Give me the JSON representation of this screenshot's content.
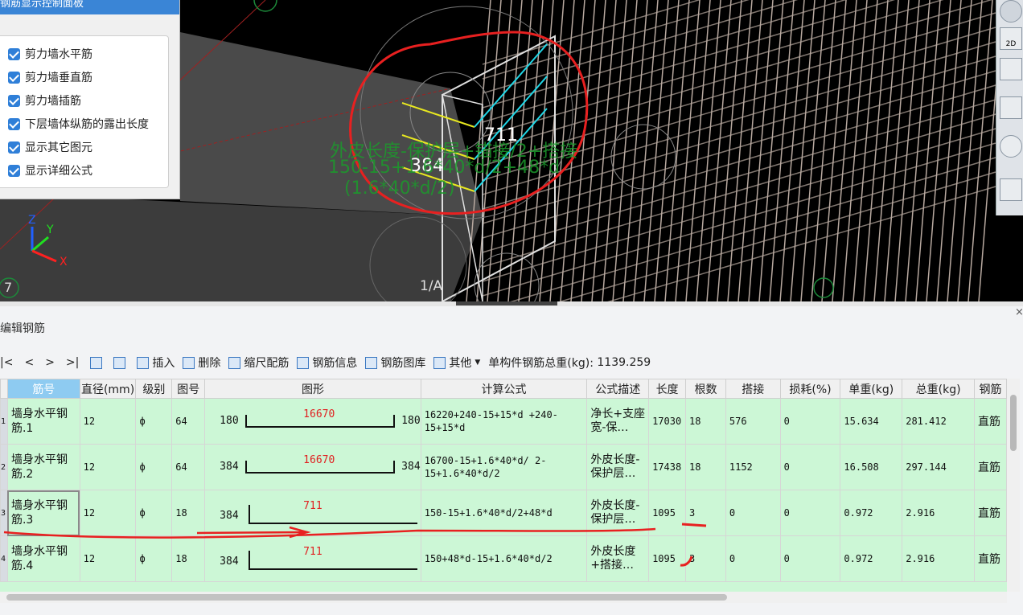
{
  "viewport": {
    "axis_labels": {
      "z": "Z",
      "y": "Y",
      "x": "X"
    },
    "grid_labels": {
      "left": "7",
      "mid": "1/A"
    },
    "dim_upper": "711",
    "dim_lower": "384",
    "overlay_lines": [
      "外皮长度-保护层+锚接/2+搭接",
      "150-15+1.6*40*d/2+48*d",
      "(1.6*40*d/2)"
    ]
  },
  "control_panel": {
    "title": "钢筋显示控制面板",
    "items": [
      "剪力墙水平筋",
      "剪力墙垂直筋",
      "剪力墙插筋",
      "下层墙体纵筋的露出长度",
      "显示其它图元",
      "显示详细公式"
    ]
  },
  "panel": {
    "title": "编辑钢筋",
    "close": "×"
  },
  "toolbar": {
    "nav": [
      "|<",
      "<",
      ">",
      ">|"
    ],
    "insert": "插入",
    "delete": "删除",
    "scale": "缩尺配筋",
    "info": "钢筋信息",
    "library": "钢筋图库",
    "other": "其他",
    "total_label": "单构件钢筋总重(kg):",
    "total_value": "1139.259"
  },
  "table": {
    "headers": [
      "筋号",
      "直径(mm)",
      "级别",
      "图号",
      "图形",
      "计算公式",
      "公式描述",
      "长度",
      "根数",
      "搭接",
      "损耗(%)",
      "单重(kg)",
      "总重(kg)",
      "钢筋"
    ],
    "rows": [
      {
        "row_no": "1",
        "name": "墙身水平钢筋.1",
        "diameter": "12",
        "grade": "ф",
        "figure_no": "64",
        "shape_left": "180",
        "shape_mid": "16670",
        "shape_right": "180",
        "formula": "16220+240-15+15*d +240-15+15*d",
        "desc": "净长+支座宽-保…",
        "length": "17030",
        "count": "18",
        "lap": "576",
        "loss": "0",
        "unit_weight": "15.634",
        "total_weight": "281.412",
        "type": "直筋"
      },
      {
        "row_no": "2",
        "name": "墙身水平钢筋.2",
        "diameter": "12",
        "grade": "ф",
        "figure_no": "64",
        "shape_left": "384",
        "shape_mid": "16670",
        "shape_right": "384",
        "formula": "16700-15+1.6*40*d/ 2-15+1.6*40*d/2",
        "desc": "外皮长度-保护层…",
        "length": "17438",
        "count": "18",
        "lap": "1152",
        "loss": "0",
        "unit_weight": "16.508",
        "total_weight": "297.144",
        "type": "直筋"
      },
      {
        "row_no": "3",
        "name": "墙身水平钢筋.3",
        "diameter": "12",
        "grade": "ф",
        "figure_no": "18",
        "shape_left": "384",
        "shape_mid": "711",
        "shape_right": "",
        "formula": "150-15+1.6*40*d/2+48*d",
        "desc": "外皮长度-保护层…",
        "length": "1095",
        "count": "3",
        "lap": "0",
        "loss": "0",
        "unit_weight": "0.972",
        "total_weight": "2.916",
        "type": "直筋"
      },
      {
        "row_no": "4",
        "name": "墙身水平钢筋.4",
        "diameter": "12",
        "grade": "ф",
        "figure_no": "18",
        "shape_left": "384",
        "shape_mid": "711",
        "shape_right": "",
        "formula": "150+48*d-15+1.6*40*d/2",
        "desc": "外皮长度+搭接…",
        "length": "1095",
        "count": "3",
        "lap": "0",
        "loss": "0",
        "unit_weight": "0.972",
        "total_weight": "2.916",
        "type": "直筋"
      }
    ]
  }
}
